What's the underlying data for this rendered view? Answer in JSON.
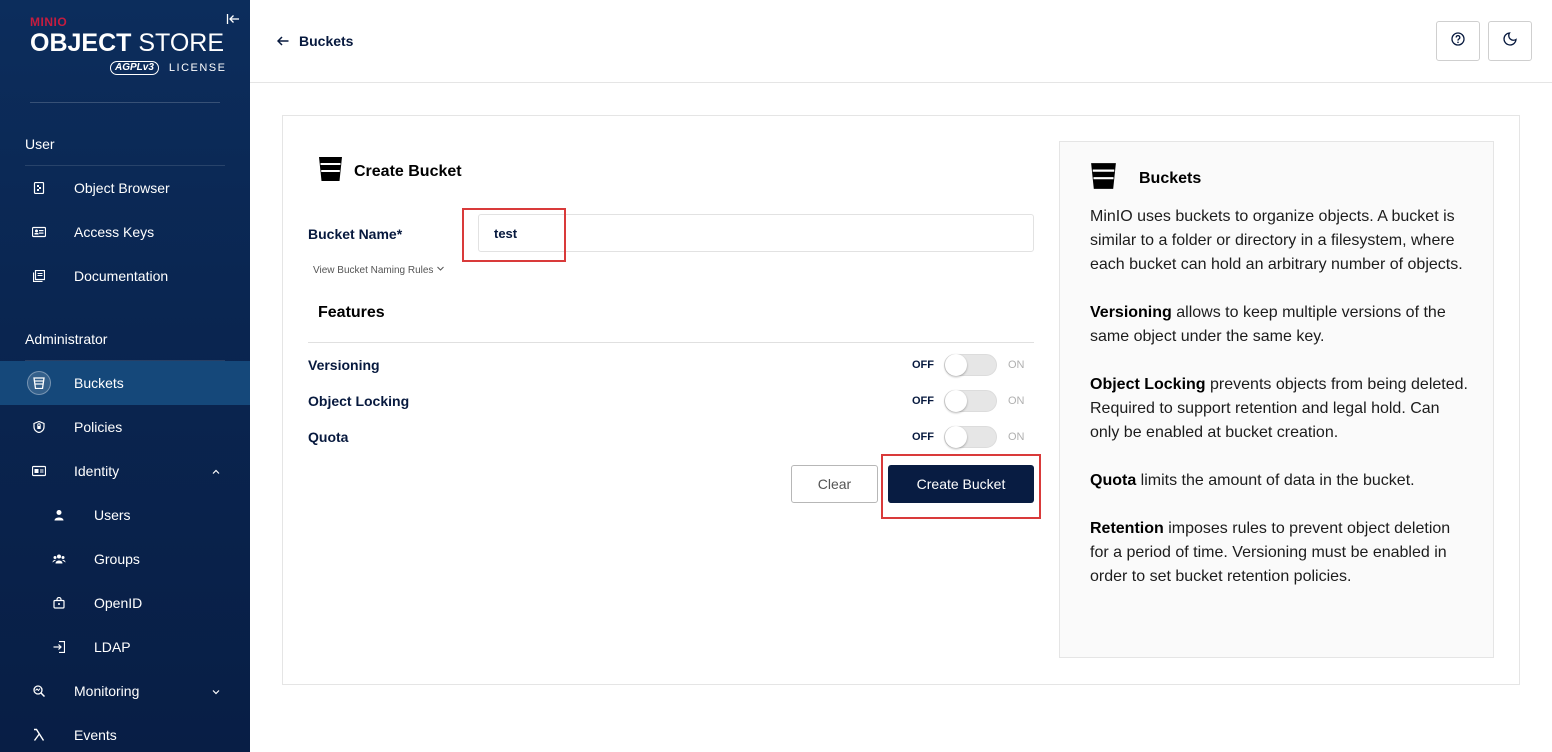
{
  "sidebar": {
    "logo": {
      "brand": "MINIO",
      "product_bold": "OBJECT",
      "product_rest": " STORE",
      "license_badge": "AGPLv3",
      "license": "LICENSE"
    },
    "sections": [
      {
        "title": "User"
      },
      {
        "title": "Administrator"
      }
    ],
    "items": [
      {
        "label": "Object Browser",
        "icon": "object-browser-icon"
      },
      {
        "label": "Access Keys",
        "icon": "access-keys-icon"
      },
      {
        "label": "Documentation",
        "icon": "documentation-icon"
      },
      {
        "label": "Buckets",
        "icon": "bucket-icon",
        "active": true
      },
      {
        "label": "Policies",
        "icon": "shield-icon"
      },
      {
        "label": "Identity",
        "icon": "identity-icon",
        "expanded": true
      },
      {
        "label": "Users",
        "icon": "user-icon"
      },
      {
        "label": "Groups",
        "icon": "groups-icon"
      },
      {
        "label": "OpenID",
        "icon": "openid-icon"
      },
      {
        "label": "LDAP",
        "icon": "ldap-icon"
      },
      {
        "label": "Monitoring",
        "icon": "monitoring-icon",
        "expanded": false
      },
      {
        "label": "Events",
        "icon": "lambda-icon"
      }
    ]
  },
  "header": {
    "back_label": "Buckets",
    "buttons": [
      "help-icon",
      "dark-mode-icon"
    ]
  },
  "form": {
    "title": "Create Bucket",
    "bucket_name_label": "Bucket Name*",
    "bucket_name_value": "test",
    "naming_rules_link": "View Bucket Naming Rules",
    "features_title": "Features",
    "features": [
      {
        "label": "Versioning",
        "off": "OFF",
        "on": "ON",
        "enabled": false
      },
      {
        "label": "Object Locking",
        "off": "OFF",
        "on": "ON",
        "enabled": false
      },
      {
        "label": "Quota",
        "off": "OFF",
        "on": "ON",
        "enabled": false
      }
    ],
    "clear_label": "Clear",
    "create_label": "Create Bucket"
  },
  "help": {
    "title": "Buckets",
    "intro": "MinIO uses buckets to organize objects. A bucket is similar to a folder or directory in a filesystem, where each bucket can hold an arbitrary number of objects.",
    "versioning_term": "Versioning",
    "versioning_text": " allows to keep multiple versions of the same object under the same key.",
    "locking_term": "Object Locking",
    "locking_text": " prevents objects from being deleted. Required to support retention and legal hold. Can only be enabled at bucket creation.",
    "quota_term": "Quota",
    "quota_text": " limits the amount of data in the bucket.",
    "retention_term": "Retention",
    "retention_text": " imposes rules to prevent object deletion for a period of time. Versioning must be enabled in order to set bucket retention policies."
  },
  "colors": {
    "sidebar_bg": "#0c2d5c",
    "active_item": "#15487a",
    "primary_button": "#081c42",
    "highlight": "#d93a3a",
    "brand_red": "#c51c3f"
  }
}
